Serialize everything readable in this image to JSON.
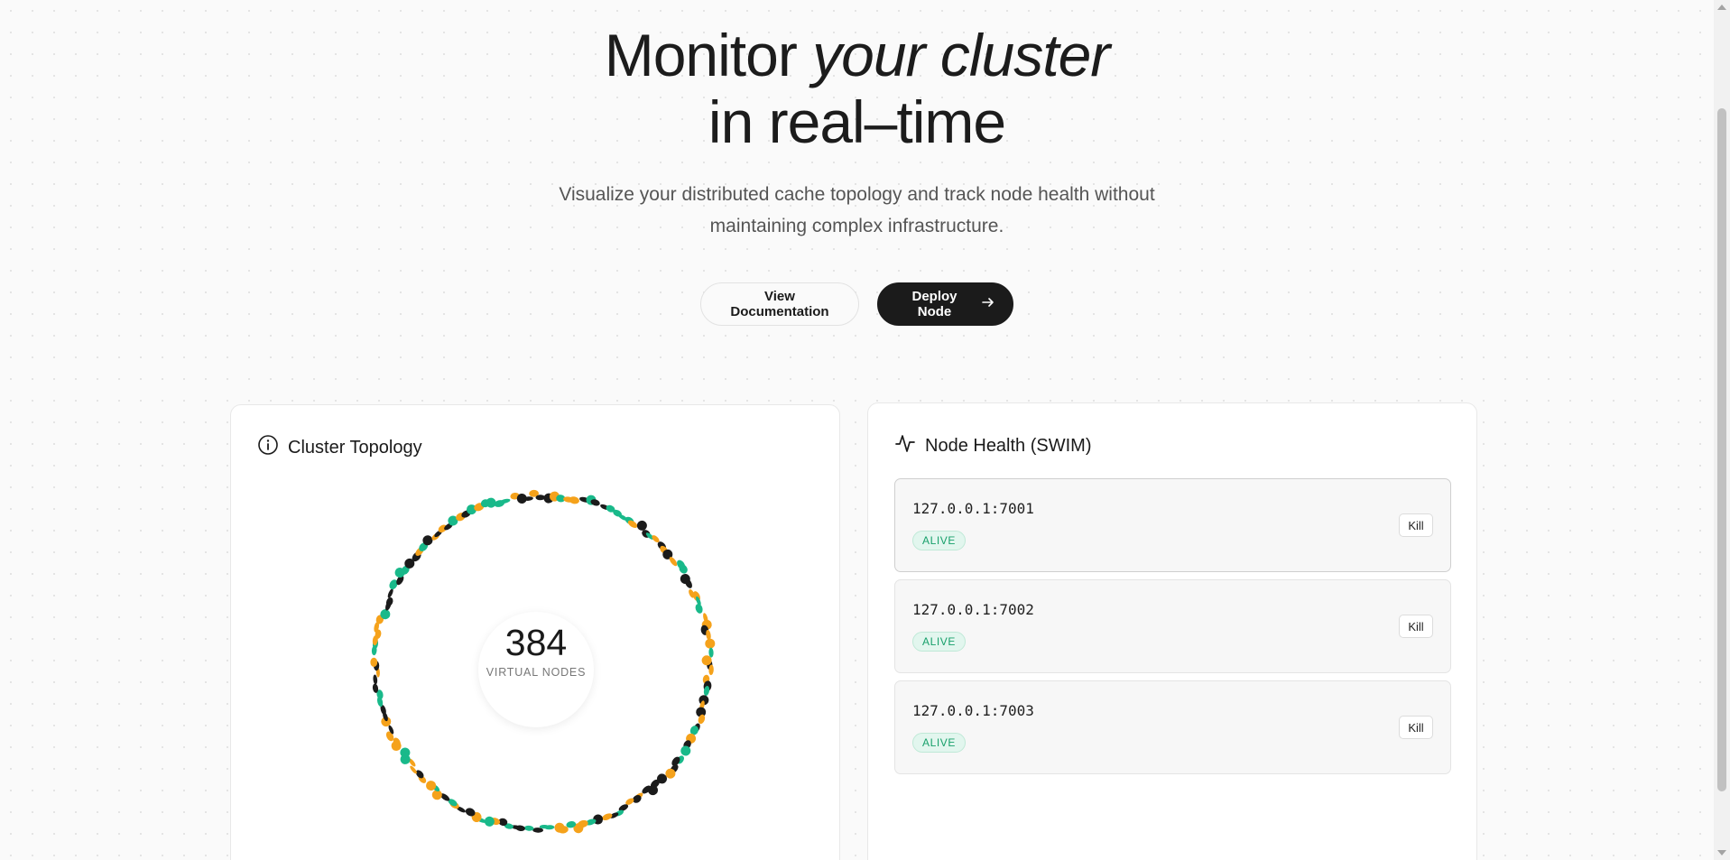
{
  "hero": {
    "headline_part1": "Monitor ",
    "headline_italic1": "your",
    "headline_space": " ",
    "headline_italic2": "cluster",
    "headline_line2": "in real–time",
    "subtitle": "Visualize your distributed cache topology and track node health without maintaining complex infrastructure."
  },
  "actions": {
    "docs_label": "View Documentation",
    "deploy_label": "Deploy Node",
    "deploy_icon": "arrow-right-icon"
  },
  "topology": {
    "title": "Cluster Topology",
    "icon": "info-icon",
    "virtual_nodes_count": "384",
    "virtual_nodes_label": "VIRTUAL NODES",
    "colors": {
      "node_a": "#1b1b1b",
      "node_b": "#f5a21b",
      "node_c": "#19b98a"
    }
  },
  "health": {
    "title": "Node Health (SWIM)",
    "icon": "activity-icon",
    "nodes": [
      {
        "address": "127.0.0.1:7001",
        "status": "ALIVE",
        "action": "Kill"
      },
      {
        "address": "127.0.0.1:7002",
        "status": "ALIVE",
        "action": "Kill"
      },
      {
        "address": "127.0.0.1:7003",
        "status": "ALIVE",
        "action": "Kill"
      }
    ]
  },
  "colors": {
    "alive_text": "#18a06b",
    "alive_bg": "#e2f6ee",
    "primary_button": "#1b1b1b"
  }
}
